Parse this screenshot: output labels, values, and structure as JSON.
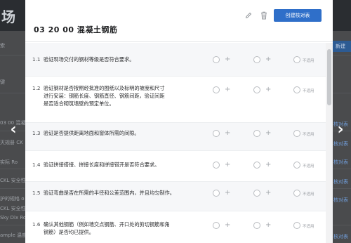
{
  "background": {
    "title_fragment": "场",
    "left_texts": [
      "索",
      "键",
      "03 00 混凝土",
      "灭规册 CK",
      "实际 Ro",
      "CKL 安全性",
      "护的规格 o",
      "CKL 安全性",
      "Sky Dix Ro",
      "ample 温度 -"
    ],
    "right_button": "新建",
    "right_links": [
      "核对表",
      "核对表",
      "核对表",
      "核对表",
      "核对表",
      "核对表"
    ]
  },
  "modal": {
    "title": "03 20 00 混凝土钢筋",
    "create_button": "创建核对表",
    "not_applicable_label": "不适用",
    "items": [
      {
        "num": "1.1",
        "lines": [
          "验证现场交付的钢材等级是否符合要求。"
        ]
      },
      {
        "num": "1.2",
        "lines": [
          "验证钢材是否按照经批准的图纸以及标明的坡度和尺寸",
          "进行安装：钢筋长度、钢筋直径、钢筋间距，验证间距",
          "是否适合砌筑墙壁的预定单位。"
        ]
      },
      {
        "num": "1.3",
        "lines": [
          "验证是否提供距离地面和窗体所需的间隙。"
        ]
      },
      {
        "num": "1.4",
        "lines": [
          "验证拼接搭接、拼接长度和拼接错开是否符合要求。"
        ]
      },
      {
        "num": "1.5",
        "lines": [
          "验证弯曲是否在所需的半径和公差范围内，并且均匀制作。"
        ]
      },
      {
        "num": "1.6",
        "lines": [
          "确认其他钢筋（例如墙交点钢筋、开口处的剪切钢筋和角",
          "钢筋）是否均已提供。"
        ]
      }
    ]
  },
  "colors": {
    "accent": "#2f6fc9",
    "overlay": "#4a4b4d"
  },
  "icons": {
    "edit": "pencil-icon",
    "delete": "trash-icon",
    "prev": "chevron-left-icon",
    "next": "chevron-right-icon"
  }
}
